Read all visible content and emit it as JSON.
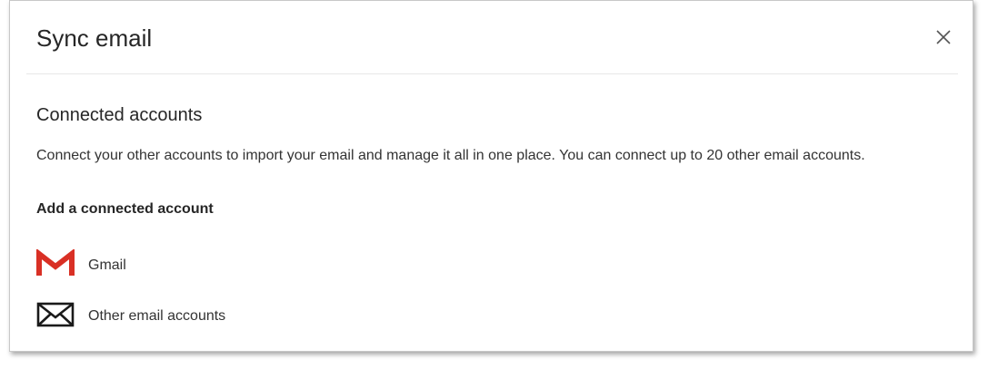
{
  "dialog": {
    "title": "Sync email",
    "close_icon": "close-icon"
  },
  "section": {
    "heading": "Connected accounts",
    "description": "Connect your other accounts to import your email and manage it all in one place. You can connect up to 20 other email accounts.",
    "add_heading": "Add a connected account"
  },
  "accounts": [
    {
      "label": "Gmail",
      "icon": "gmail-icon",
      "icon_color": "#d93025"
    },
    {
      "label": "Other email accounts",
      "icon": "envelope-icon",
      "icon_color": "#1a1a1a"
    }
  ]
}
